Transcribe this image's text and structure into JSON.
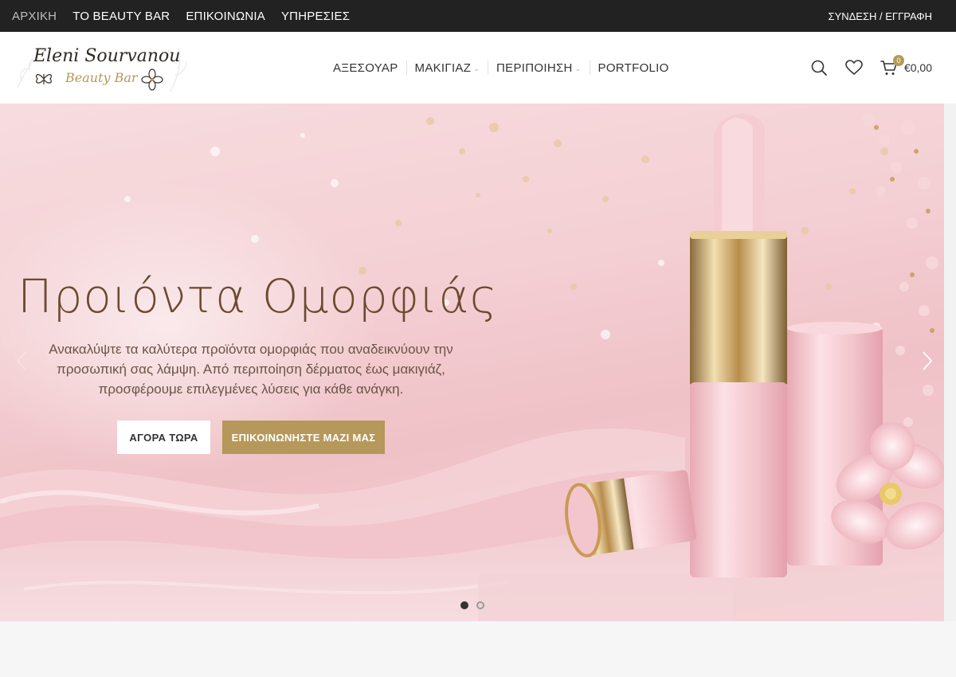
{
  "topbar": {
    "links": [
      {
        "label": "ΑΡΧΙΚΗ",
        "active": true
      },
      {
        "label": "ΤΟ BEAUTY BAR",
        "active": false
      },
      {
        "label": "ΕΠΙΚΟΙΝΩΝΙΑ",
        "active": false
      },
      {
        "label": "ΥΠΗΡΕΣΙΕΣ",
        "active": false
      }
    ],
    "account_label": "ΣΥΝΔΕΣΗ / ΕΓΓΡΑΦΗ"
  },
  "logo": {
    "line1": "Eleni Sourvanou",
    "line2": "Beauty Bar"
  },
  "nav": {
    "items": [
      {
        "label": "ΑΞΕΣΟΥΑΡ",
        "has_dropdown": false
      },
      {
        "label": "ΜΑΚΙΓΙΑΖ",
        "has_dropdown": true
      },
      {
        "label": "ΠΕΡΙΠΟΙΗΣΗ",
        "has_dropdown": true
      },
      {
        "label": "PORTFOLIO",
        "has_dropdown": false
      }
    ]
  },
  "header_icons": {
    "search": "search-icon",
    "wishlist": "heart-icon",
    "cart": "cart-icon",
    "cart_count": "0",
    "cart_total": "€0,00"
  },
  "hero": {
    "title": "Προιόντα Ομορφιάς",
    "text": "Ανακαλύψτε τα καλύτερα προϊόντα ομορφιάς που αναδεικνύουν την προσωπική σας λάμψη. Από περιποίηση δέρματος έως μακιγιάζ, προσφέρουμε επιλεγμένες λύσεις για κάθε ανάγκη.",
    "buttons": {
      "shop": "ΑΓΟΡΑ ΤΩΡΑ",
      "contact": "ΕΠΙΚΟΙΝΩΝΗΣΤΕ ΜΑΖΙ ΜΑΣ"
    },
    "slides": {
      "count": 2,
      "active_index": 0
    }
  },
  "colors": {
    "topbar_bg": "#222222",
    "accent_gold": "#b5985a",
    "hero_title": "#6b4a2f",
    "hero_pink": "#f4d0d4"
  }
}
